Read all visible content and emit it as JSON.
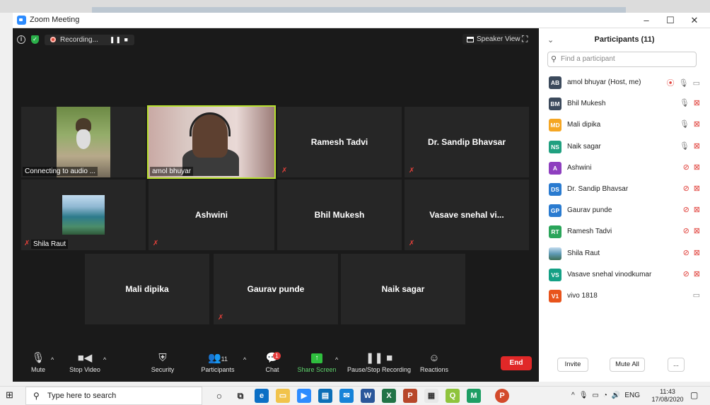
{
  "window": {
    "title": "Zoom Meeting",
    "minimize": "–",
    "maximize": "☐",
    "close": "✕"
  },
  "topbar": {
    "recording_label": "Recording...",
    "recording_controls": "❚❚ ■",
    "speaker_view_label": "Speaker View"
  },
  "tiles": [
    {
      "id": "connecting",
      "label": "Connecting to audio ..."
    },
    {
      "id": "amol",
      "label": "amol bhuyar"
    },
    {
      "id": "ramesh",
      "name": "Ramesh Tadvi"
    },
    {
      "id": "sandip",
      "name": "Dr. Sandip Bhavsar"
    },
    {
      "id": "shila",
      "label": "Shila Raut"
    },
    {
      "id": "ashwini",
      "name": "Ashwini"
    },
    {
      "id": "bhil",
      "name": "Bhil Mukesh"
    },
    {
      "id": "vasave",
      "name": "Vasave snehal vi..."
    },
    {
      "id": "mali",
      "name": "Mali dipika"
    },
    {
      "id": "gaurav",
      "name": "Gaurav punde"
    },
    {
      "id": "naik",
      "name": "Naik sagar"
    }
  ],
  "toolbar": {
    "mute": "Mute",
    "stop_video": "Stop Video",
    "security": "Security",
    "participants": "Participants",
    "participants_count": "11",
    "chat": "Chat",
    "chat_badge": "1",
    "share_screen": "Share Screen",
    "pause_stop_recording": "Pause/Stop Recording",
    "reactions": "Reactions",
    "end": "End"
  },
  "panel": {
    "title": "Participants (11)",
    "search_placeholder": "Find a participant",
    "participants": [
      {
        "initials": "AB",
        "name": "amol bhuyar (Host, me)",
        "color": "#3c4a5c",
        "recording": true,
        "mic": "on",
        "cam": "on"
      },
      {
        "initials": "BM",
        "name": "Bhil Mukesh",
        "color": "#3c4a5c",
        "mic": "on",
        "cam": "off"
      },
      {
        "initials": "MD",
        "name": "Mali dipika",
        "color": "#f5a623",
        "mic": "on",
        "cam": "off"
      },
      {
        "initials": "NS",
        "name": "Naik sagar",
        "color": "#20a080",
        "mic": "on",
        "cam": "off"
      },
      {
        "initials": "A",
        "name": "Ashwini",
        "color": "#8e3fbf",
        "mic": "off",
        "cam": "off"
      },
      {
        "initials": "DS",
        "name": "Dr. Sandip Bhavsar",
        "color": "#2a7bd0",
        "mic": "off",
        "cam": "off"
      },
      {
        "initials": "GP",
        "name": "Gaurav punde",
        "color": "#2a7bd0",
        "mic": "off",
        "cam": "off"
      },
      {
        "initials": "RT",
        "name": "Ramesh Tadvi",
        "color": "#2aa55a",
        "mic": "off",
        "cam": "off"
      },
      {
        "initials": "",
        "name": "Shila Raut",
        "color": "#6a8fb0",
        "mic": "off",
        "cam": "off"
      },
      {
        "initials": "VS",
        "name": "Vasave snehal vinodkumar",
        "color": "#14a085",
        "mic": "off",
        "cam": "off"
      },
      {
        "initials": "V1",
        "name": "vivo 1818",
        "color": "#e8541c",
        "mic": "none",
        "cam": "on"
      }
    ],
    "invite": "Invite",
    "mute_all": "Mute All",
    "more": "..."
  },
  "taskbar": {
    "search_placeholder": "Type here to search",
    "language": "ENG",
    "time": "11:43",
    "date": "17/08/2020"
  }
}
